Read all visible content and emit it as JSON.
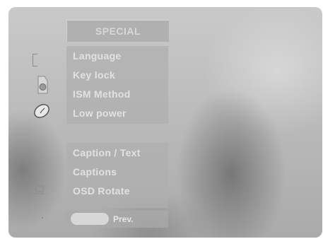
{
  "menu": {
    "title": "SPECIAL",
    "group1": [
      "Language",
      "Key lock",
      "ISM Method",
      "Low power"
    ],
    "group2": [
      "Caption / Text",
      "Captions",
      "OSD Rotate"
    ]
  },
  "footer": {
    "prev_label": "Prev."
  },
  "icons": [
    "bracket-icon",
    "speaker-icon",
    "clock-icon",
    "screen-icon",
    "dot-icon"
  ],
  "colors": {
    "panel": "#afafaf",
    "text": "#e2e2e2",
    "background": "#bdbdbd"
  }
}
